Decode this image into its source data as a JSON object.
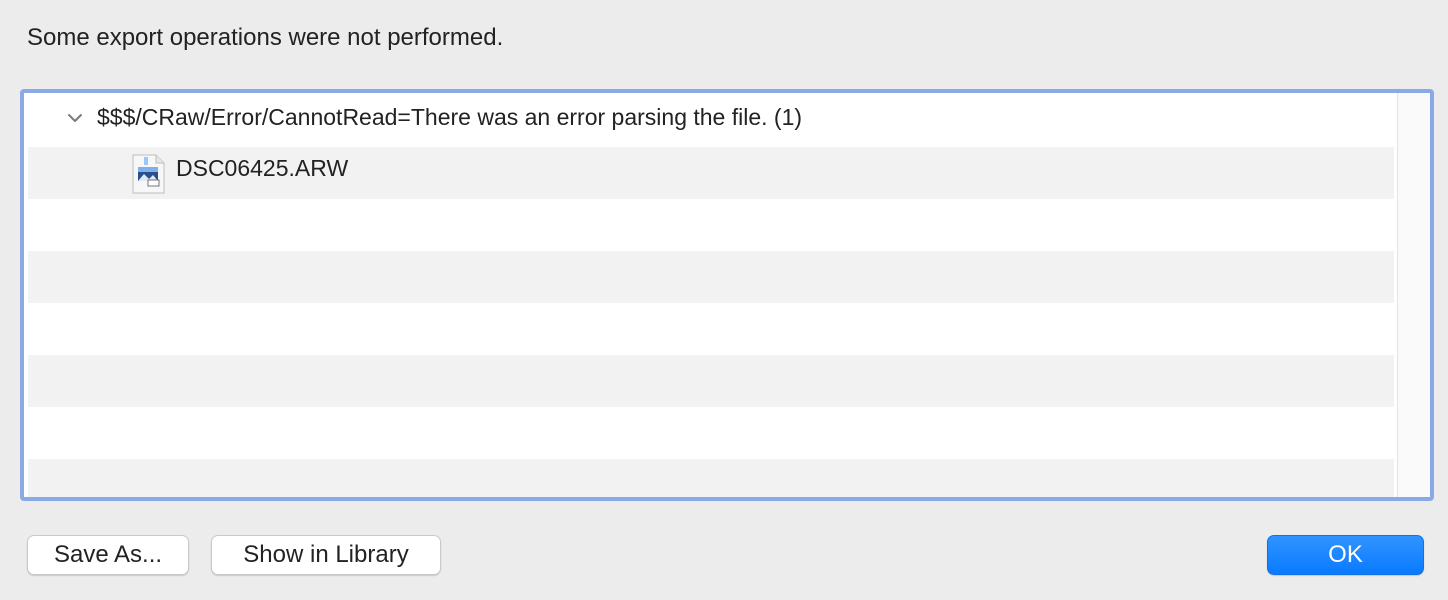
{
  "dialog": {
    "message": "Some export operations were not performed."
  },
  "outline": {
    "group_label": "$$$/CRaw/Error/CannotRead=There was an error parsing the file. (1)",
    "group_expanded": true,
    "group_icon": "chevron-down-icon",
    "items": [
      {
        "label": "DSC06425.ARW",
        "icon": "raw-image-file-icon"
      }
    ]
  },
  "buttons": {
    "save_as": "Save As...",
    "show_in_library": "Show in Library",
    "ok": "OK"
  },
  "colors": {
    "focus_ring": "#8aaae6",
    "primary_button": "#0a7aff",
    "row_alt": "#f2f2f2"
  }
}
